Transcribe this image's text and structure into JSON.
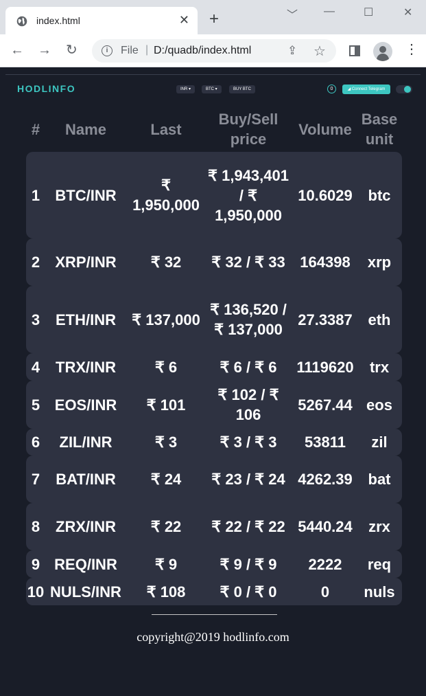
{
  "browser": {
    "tab_title": "index.html",
    "tab_close": "✕",
    "new_tab": "+",
    "min": "﹀",
    "minimize": "—",
    "maximize": "☐",
    "close": "✕",
    "back": "←",
    "forward": "→",
    "reload": "↻",
    "file_label": "File",
    "separator": "|",
    "url": "D:/quadb/index.html",
    "share": "⇪",
    "star": "☆",
    "menu": "⋮"
  },
  "header": {
    "logo": "HODLINFO",
    "currency_select": "INR ▾",
    "coin_select": "BTC ▾",
    "buy_label": "BUY BTC",
    "timer": "0",
    "telegram": "◢ Connect Telegram"
  },
  "table": {
    "headers": [
      "#",
      "Name",
      "Last",
      "Buy/Sell price",
      "Volume",
      "Base unit"
    ],
    "rows": [
      {
        "n": "1",
        "name": "BTC/INR",
        "last": "₹ 1,950,000",
        "buysell": "₹ 1,943,401 / ₹ 1,950,000",
        "volume": "10.6029",
        "base": "btc"
      },
      {
        "n": "2",
        "name": "XRP/INR",
        "last": "₹ 32",
        "buysell": "₹ 32 / ₹ 33",
        "volume": "164398",
        "base": "xrp"
      },
      {
        "n": "3",
        "name": "ETH/INR",
        "last": "₹ 137,000",
        "buysell": "₹ 136,520 / ₹ 137,000",
        "volume": "27.3387",
        "base": "eth"
      },
      {
        "n": "4",
        "name": "TRX/INR",
        "last": "₹ 6",
        "buysell": "₹ 6 / ₹ 6",
        "volume": "1119620",
        "base": "trx"
      },
      {
        "n": "5",
        "name": "EOS/INR",
        "last": "₹ 101",
        "buysell": "₹ 102 / ₹ 106",
        "volume": "5267.44",
        "base": "eos"
      },
      {
        "n": "6",
        "name": "ZIL/INR",
        "last": "₹ 3",
        "buysell": "₹ 3 / ₹ 3",
        "volume": "53811",
        "base": "zil"
      },
      {
        "n": "7",
        "name": "BAT/INR",
        "last": "₹ 24",
        "buysell": "₹ 23 / ₹ 24",
        "volume": "4262.39",
        "base": "bat"
      },
      {
        "n": "8",
        "name": "ZRX/INR",
        "last": "₹ 22",
        "buysell": "₹ 22 / ₹ 22",
        "volume": "5440.24",
        "base": "zrx"
      },
      {
        "n": "9",
        "name": "REQ/INR",
        "last": "₹ 9",
        "buysell": "₹ 9 / ₹ 9",
        "volume": "2222",
        "base": "req"
      },
      {
        "n": "10",
        "name": "NULS/INR",
        "last": "₹ 108",
        "buysell": "₹ 0 / ₹ 0",
        "volume": "0",
        "base": "nuls"
      }
    ]
  },
  "footer": {
    "copyright": "copyright@2019 hodlinfo.com"
  },
  "colors": {
    "background": "#191d28",
    "row_bg": "#2e3241",
    "accent": "#3dc6c1",
    "header_text": "#8a8d97"
  }
}
